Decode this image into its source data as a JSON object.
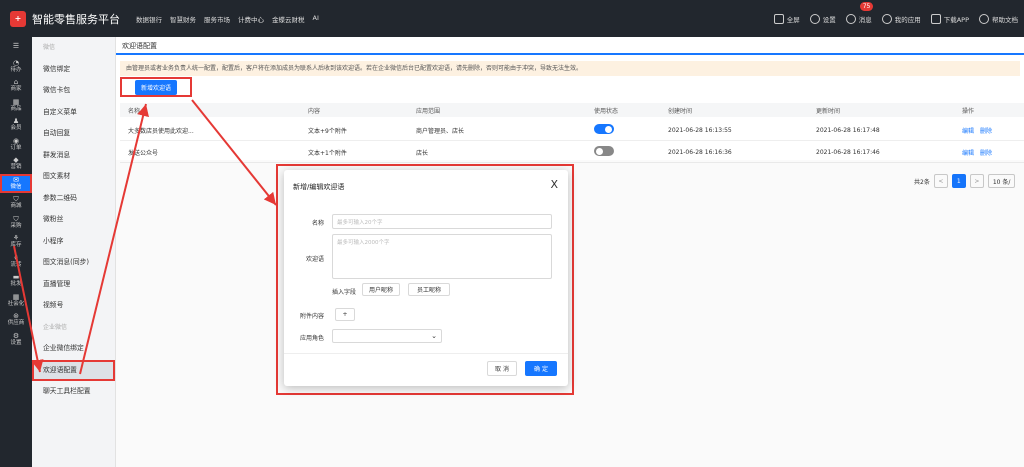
{
  "app": {
    "logo_text": "+",
    "title": "智能零售服务平台"
  },
  "topnav": [
    "数据银行",
    "智慧财务",
    "服务市场",
    "计费中心",
    "金蝶云财税",
    "AI"
  ],
  "topright": {
    "fullscreen": "全屏",
    "settings": "设置",
    "messages": "消息",
    "messages_badge": "75",
    "my_apps": "我的应用",
    "download_app": "下载APP",
    "help": "帮助文档"
  },
  "rail": [
    {
      "icon": "☰",
      "label": ""
    },
    {
      "icon": "◔",
      "label": "待办"
    },
    {
      "icon": "⌂",
      "label": "商家"
    },
    {
      "icon": "▦",
      "label": "商品"
    },
    {
      "icon": "♟",
      "label": "会员"
    },
    {
      "icon": "◉",
      "label": "订单"
    },
    {
      "icon": "◆",
      "label": "营销"
    },
    {
      "icon": "✉",
      "label": "微信"
    },
    {
      "icon": "⛉",
      "label": "商城"
    },
    {
      "icon": "⛉",
      "label": "采购"
    },
    {
      "icon": "⚘",
      "label": "库存"
    },
    {
      "icon": "⚱",
      "label": "流转"
    },
    {
      "icon": "▬",
      "label": "批发"
    },
    {
      "icon": "▦",
      "label": "社会化"
    },
    {
      "icon": "⊛",
      "label": "供应商"
    },
    {
      "icon": "⚙",
      "label": "设置"
    }
  ],
  "submenu": [
    {
      "label": "微信",
      "grey": true
    },
    {
      "label": "微信绑定"
    },
    {
      "label": "微信卡包"
    },
    {
      "label": "自定义菜单"
    },
    {
      "label": "自动回复"
    },
    {
      "label": "群发消息"
    },
    {
      "label": "图文素材"
    },
    {
      "label": "参数二维码"
    },
    {
      "label": "微粉丝"
    },
    {
      "label": "小程序"
    },
    {
      "label": "图文消息(同步)"
    },
    {
      "label": "直播管理"
    },
    {
      "label": "视频号"
    },
    {
      "label": "企业微信",
      "grey": true
    },
    {
      "label": "企业微信绑定"
    },
    {
      "label": "欢迎语配置",
      "active": true
    },
    {
      "label": "聊天工具栏配置"
    }
  ],
  "page": {
    "title": "欢迎语配置",
    "notice": "由管理员或者业务负责人统一配置，配置后，客户将在添加成员为联系人后收到该欢迎语。若在企业微信后台已配置欢迎语，请先删除，否则可能由于冲突，导致无法生效。",
    "add_button": "新增欢迎语"
  },
  "table": {
    "headers": [
      "名称",
      "内容",
      "应用范围",
      "使用状态",
      "创建时间",
      "更新时间",
      "操作"
    ],
    "rows": [
      {
        "name": "大多数店员使用此欢迎...",
        "content": "文本+9个附件",
        "scope": "商户管理员、店长",
        "enabled": true,
        "created": "2021-06-28 16:13:55",
        "updated": "2021-06-28 16:17:48",
        "edit": "编辑",
        "delete": "删除"
      },
      {
        "name": "发送公众号",
        "content": "文本+1个附件",
        "scope": "店长",
        "enabled": false,
        "created": "2021-06-28 16:16:36",
        "updated": "2021-06-28 16:17:46",
        "edit": "编辑",
        "delete": "删除"
      }
    ]
  },
  "pager": {
    "total": "共2条",
    "prev": "<",
    "current": "1",
    "next": ">",
    "size": "10 条/"
  },
  "modal": {
    "title": "新增/编辑欢迎语",
    "close": "X",
    "name_label": "名称",
    "name_placeholder": "最多可输入20个字",
    "greeting_label": "欢迎语",
    "greeting_placeholder": "最多可输入2000个字",
    "insert_label": "插入字段",
    "chip_user_nick": "用户昵称",
    "chip_staff_nick": "员工昵称",
    "attachment_label": "附件内容",
    "attachment_btn": "+",
    "role_label": "应用角色",
    "role_value": "",
    "cancel": "取 消",
    "ok": "确 定"
  }
}
